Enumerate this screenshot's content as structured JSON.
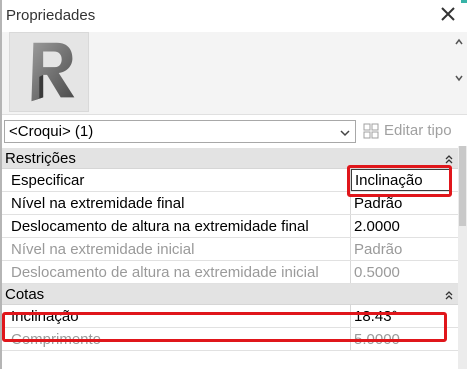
{
  "panel": {
    "title": "Propriedades"
  },
  "type_selector": {
    "selected": "<Croqui> (1)",
    "edit_type_label": "Editar tipo"
  },
  "categories": [
    {
      "label": "Restrições",
      "properties": [
        {
          "name": "Especificar",
          "value": "Inclinação",
          "enabled": true
        },
        {
          "name": "Nível na extremidade final",
          "value": "Padrão",
          "enabled": true
        },
        {
          "name": "Deslocamento de altura na extremidade final",
          "value": "2.0000",
          "enabled": true
        },
        {
          "name": "Nível na extremidade inicial",
          "value": "Padrão",
          "enabled": false
        },
        {
          "name": "Deslocamento de altura na extremidade inicial",
          "value": "0.5000",
          "enabled": false
        }
      ]
    },
    {
      "label": "Cotas",
      "properties": [
        {
          "name": "Inclinação",
          "value": "18.43°",
          "enabled": true
        },
        {
          "name": "Comprimento",
          "value": "5.0000",
          "enabled": false
        }
      ]
    }
  ],
  "colors": {
    "highlight": "#e0161b",
    "category_bg": "#e3e3e3",
    "muted_text": "#9a9a9a",
    "accent": "#36b3a7"
  }
}
